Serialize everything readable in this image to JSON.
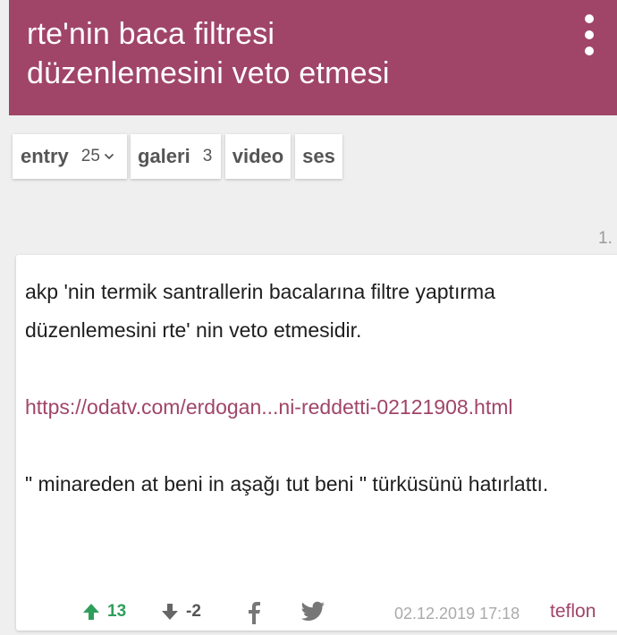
{
  "header": {
    "title_line1": "rte'nin baca filtresi",
    "title_line2": "düzenlemesini veto etmesi",
    "menu_icon": "more-vertical-icon",
    "bg_color": "#a04568"
  },
  "tabs": [
    {
      "label": "entry",
      "count": "25",
      "has_dropdown": true
    },
    {
      "label": "galeri",
      "count": "3"
    },
    {
      "label": "video"
    },
    {
      "label": "ses"
    }
  ],
  "entry": {
    "index": "1.",
    "paragraph1": "akp 'nin termik santrallerin bacalarına filtre yaptırma düzenlemesini rte' nin veto etmesidir.",
    "link_text": "https://odatv.com/erdogan...ni-reddetti-02121908.html",
    "paragraph3": "\" minareden at beni in aşağı tut beni \" türküsünü hatırlattı.",
    "upvotes": "13",
    "downvotes": "-2",
    "date": "02.12.2019 17:18",
    "author": "teflon",
    "link_color": "#a04568",
    "upvote_color": "#2e9e5b"
  }
}
